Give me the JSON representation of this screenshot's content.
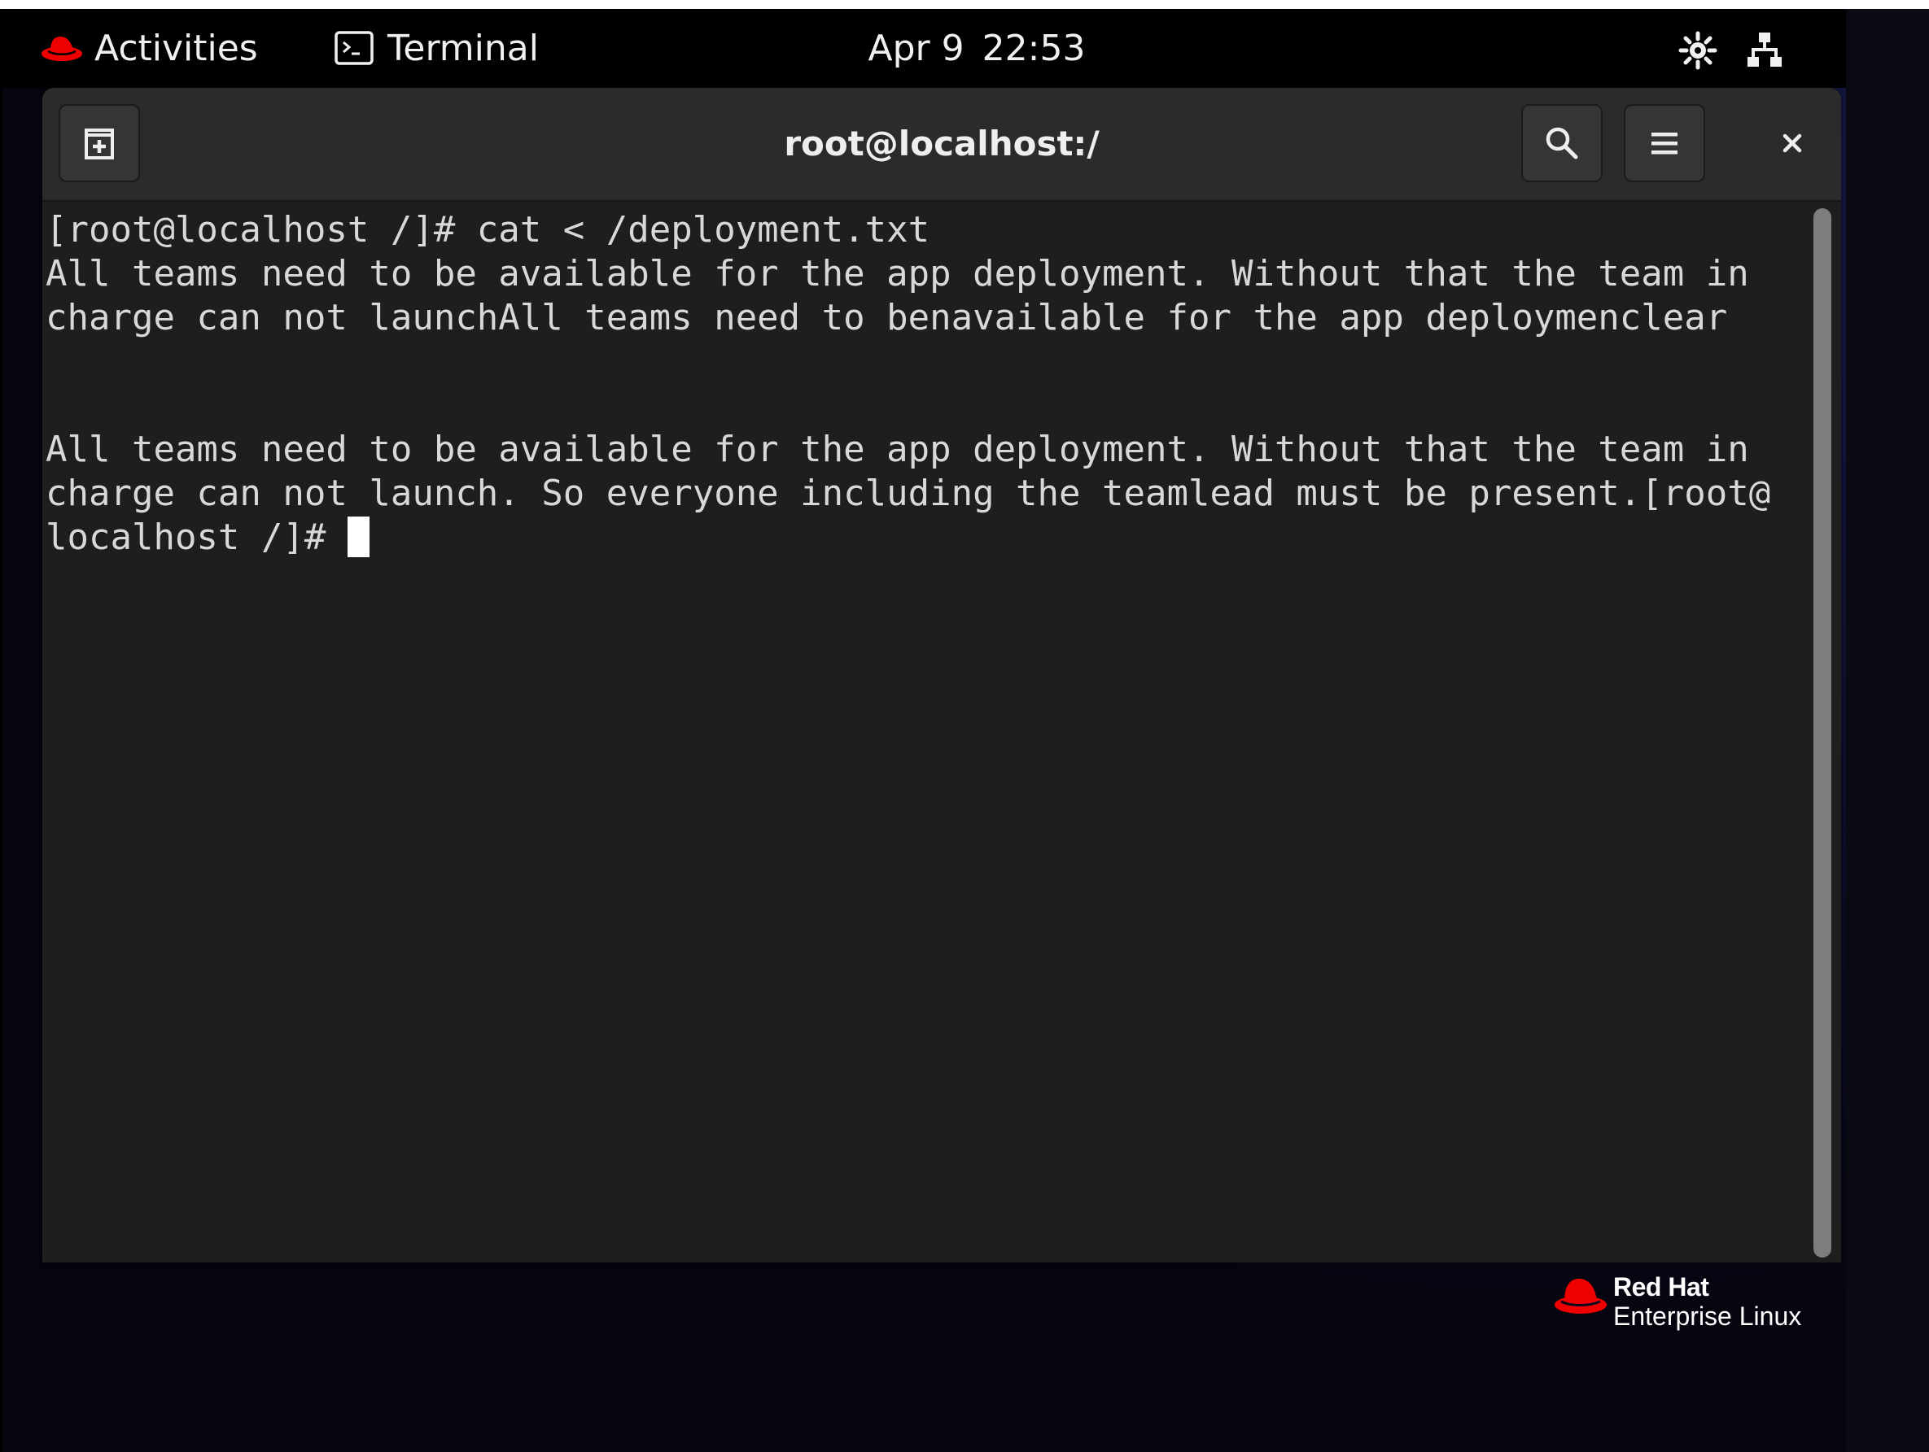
{
  "topbar": {
    "activities_label": "Activities",
    "app_label": "Terminal",
    "date": "Apr 9",
    "time": "22:53",
    "tray_icons": [
      "accessibility-icon",
      "network-wired-icon",
      "battery-charging-icon"
    ]
  },
  "window": {
    "title": "root@localhost:/",
    "buttons": [
      "new-tab-icon",
      "search-icon",
      "hamburger-menu-icon",
      "close-icon"
    ]
  },
  "terminal": {
    "lines": [
      "[root@localhost /]# cat < /deployment.txt",
      "All teams need to be available for the app deployment. Without that the team in",
      "charge can not launchAll teams need to benavailable for the app deploymenclear",
      "",
      "",
      "All teams need to be available for the app deployment. Without that the team in",
      "charge can not launch. So everyone including the teamlead must be present.[root@"
    ],
    "prompt_line": "localhost /]# "
  },
  "branding": {
    "line1": "Red Hat",
    "line2": "Enterprise Linux"
  },
  "colors": {
    "brand_red": "#ee0000",
    "terminal_bg": "#1e1e1e",
    "headerbar_bg": "#2b2b2b",
    "text": "#d8d8d8"
  }
}
